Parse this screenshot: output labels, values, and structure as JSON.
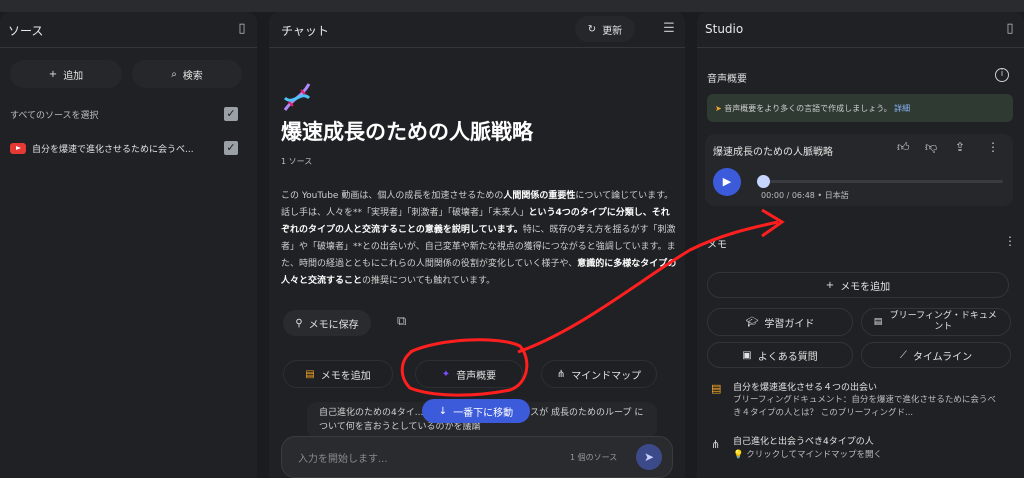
{
  "sources": {
    "title": "ソース",
    "add_label": "追加",
    "search_label": "検索",
    "select_all_label": "すべてのソースを選択",
    "items": [
      {
        "label": "自分を爆速で進化させるために会うべ..."
      }
    ]
  },
  "chat": {
    "title": "チャット",
    "refresh_label": "更新",
    "notebook_title": "爆速成長のための人脈戦略",
    "source_count": "1 ソース",
    "summary_parts": [
      {
        "t": "この YouTube 動画は、個人の成長を加速させるための",
        "b": false
      },
      {
        "t": "人間関係の重要性",
        "b": true
      },
      {
        "t": "について論じています。話し手は、人々を**「実現者」「刺激者」「破壊者」「未来人」",
        "b": false
      },
      {
        "t": "という4つのタイプに分類し、それぞれのタイプの人と交流することの意義を説明しています。",
        "b": true
      },
      {
        "t": "特に、既存の考え方を揺るがす「刺激者」や「破壊者」**との出会いが、自己変革や新たな視点の獲得につながると強調しています。また、時間の経過とともにこれらの人間関係の役割が変化していく様子や、",
        "b": false
      },
      {
        "t": "意識的に多様なタイプの人々と交流すること",
        "b": true
      },
      {
        "t": "の推奨についても触れています。",
        "b": false
      }
    ],
    "save_memo_label": "メモに保存",
    "add_memo_label": "メモを追加",
    "audio_overview_label": "音声概要",
    "mindmap_label": "マインドマップ",
    "jump_bottom_label": "一番下に移動",
    "suggestion_text": "自己進化のための4タイ...題において、これらのソースが 成長のためのループ について何を言おうとしているのかを議論",
    "input_placeholder": "入力を開始します...",
    "source_count_input": "1 個のソース"
  },
  "studio": {
    "title": "Studio",
    "audio_section_title": "音声概要",
    "banner_text": "音声概要をより多くの言語で作成しましょう。",
    "banner_link": "詳細",
    "audio_title": "爆速成長のための人脈戦略",
    "audio_time": "00:00 / 06:48 • 日本語",
    "audio_progress": 0,
    "memo_title": "メモ",
    "add_memo_label": "メモを追加",
    "study_guide_label": "学習ガイド",
    "briefing_label": "ブリーフィング・ドキュメント",
    "faq_label": "よくある質問",
    "timeline_label": "タイムライン",
    "notes": [
      {
        "title": "自分を爆速進化させる４つの出会い",
        "body": "ブリーフィングドキュメント：自分を爆速で進化させるために会うべき４タイプの人とは？ このブリーフィングド..."
      },
      {
        "title": "自己進化と出会うべき4タイプの人",
        "body": "💡 クリックしてマインドマップを開く"
      }
    ]
  },
  "colors": {
    "accent_blue": "#4285f4",
    "annotation_red": "#ff1f1f"
  }
}
